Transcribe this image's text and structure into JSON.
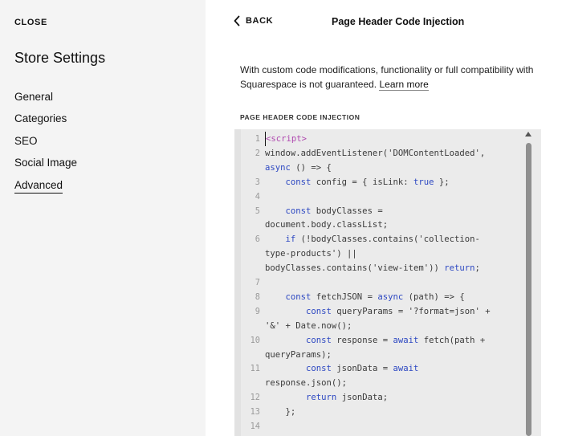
{
  "sidebar": {
    "close_label": "CLOSE",
    "title": "Store Settings",
    "items": [
      {
        "label": "General"
      },
      {
        "label": "Categories"
      },
      {
        "label": "SEO"
      },
      {
        "label": "Social Image"
      },
      {
        "label": "Advanced",
        "active": true
      }
    ]
  },
  "header": {
    "back_label": "BACK",
    "title": "Page Header Code Injection"
  },
  "content": {
    "description_line1": "With custom code modifications, functionality or full compatibility with",
    "description_line2": "Squarespace is not guaranteed.",
    "learn_more_label": "Learn more",
    "section_label": "PAGE HEADER CODE INJECTION"
  },
  "editor": {
    "lines": [
      {
        "num": "1",
        "text": "<script>"
      },
      {
        "num": "2",
        "text": "window.addEventListener('DOMContentLoaded',"
      },
      {
        "num": "",
        "text": "async () => {"
      },
      {
        "num": "3",
        "text": "    const config = { isLink: true };"
      },
      {
        "num": "4",
        "text": ""
      },
      {
        "num": "5",
        "text": "    const bodyClasses ="
      },
      {
        "num": "",
        "text": "document.body.classList;"
      },
      {
        "num": "6",
        "text": "    if (!bodyClasses.contains('collection-"
      },
      {
        "num": "",
        "text": "type-products') ||"
      },
      {
        "num": "",
        "text": "bodyClasses.contains('view-item')) return;"
      },
      {
        "num": "7",
        "text": ""
      },
      {
        "num": "8",
        "text": "    const fetchJSON = async (path) => {"
      },
      {
        "num": "9",
        "text": "        const queryParams = '?format=json' +"
      },
      {
        "num": "",
        "text": "'&' + Date.now();"
      },
      {
        "num": "10",
        "text": "        const response = await fetch(path +"
      },
      {
        "num": "",
        "text": "queryParams);"
      },
      {
        "num": "11",
        "text": "        const jsonData = await"
      },
      {
        "num": "",
        "text": "response.json();"
      },
      {
        "num": "12",
        "text": "        return jsonData;"
      },
      {
        "num": "13",
        "text": "    };"
      },
      {
        "num": "14",
        "text": ""
      }
    ]
  }
}
